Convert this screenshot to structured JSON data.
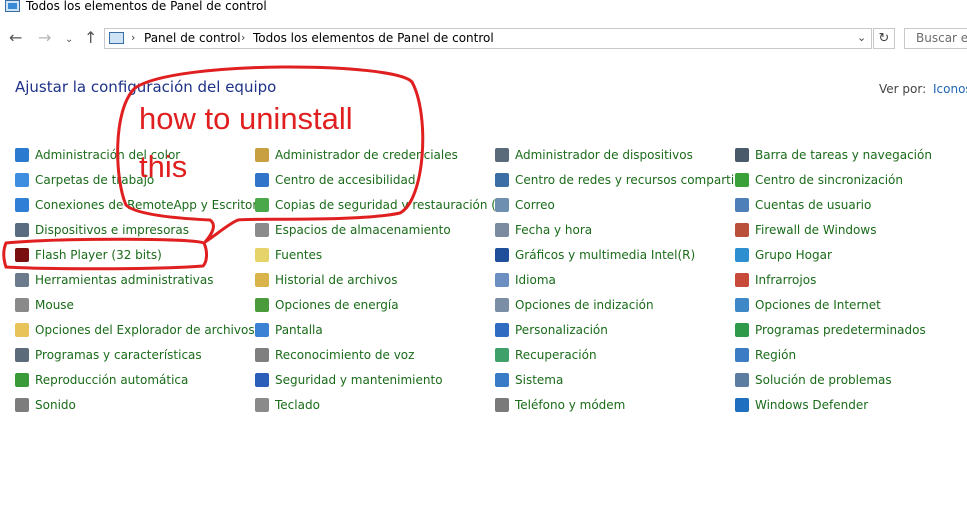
{
  "window": {
    "title": "Todos los elementos de Panel de control"
  },
  "nav": {
    "back_icon": "arrow-left-icon",
    "forward_icon": "arrow-right-icon",
    "recent_icon": "chevron-down-icon",
    "up_icon": "arrow-up-icon",
    "breadcrumbs": [
      "Panel de control",
      "Todos los elementos de Panel de control"
    ],
    "refresh_icon": "refresh-icon",
    "search_placeholder": "Buscar en"
  },
  "header": {
    "title": "Ajustar la configuración del equipo",
    "view_by_label": "Ver por:",
    "view_by_value": "Iconos"
  },
  "columns": [
    [
      {
        "label": "Administración del color",
        "icon": "monitor-color-icon",
        "color": "#2a7bd0"
      },
      {
        "label": "Carpetas de trabajo",
        "icon": "work-folders-icon",
        "color": "#3d8ee0"
      },
      {
        "label": "Conexiones de RemoteApp y Escritorio",
        "icon": "remoteapp-icon",
        "color": "#2f7fd6"
      },
      {
        "label": "Dispositivos e impresoras",
        "icon": "printer-icon",
        "color": "#5a6d80"
      },
      {
        "label": "Flash Player (32 bits)",
        "icon": "flash-player-icon",
        "color": "#7a0f0f"
      },
      {
        "label": "Herramientas administrativas",
        "icon": "admin-tools-icon",
        "color": "#6b7b8c"
      },
      {
        "label": "Mouse",
        "icon": "mouse-icon",
        "color": "#8a8a8a"
      },
      {
        "label": "Opciones del Explorador de archivos",
        "icon": "folder-options-icon",
        "color": "#e8c35a"
      },
      {
        "label": "Programas y características",
        "icon": "programs-icon",
        "color": "#5c6b7a"
      },
      {
        "label": "Reproducción automática",
        "icon": "autoplay-icon",
        "color": "#3a9a3a"
      },
      {
        "label": "Sonido",
        "icon": "speaker-icon",
        "color": "#7d7d7d"
      }
    ],
    [
      {
        "label": "Administrador de credenciales",
        "icon": "credential-vault-icon",
        "color": "#c8a040"
      },
      {
        "label": "Centro de accesibilidad",
        "icon": "accessibility-icon",
        "color": "#2f74c8"
      },
      {
        "label": "Copias de seguridad y restauración (…",
        "icon": "backup-icon",
        "color": "#4aa84a"
      },
      {
        "label": "Espacios de almacenamiento",
        "icon": "storage-spaces-icon",
        "color": "#8b8b8b"
      },
      {
        "label": "Fuentes",
        "icon": "fonts-icon",
        "color": "#e6d36a"
      },
      {
        "label": "Historial de archivos",
        "icon": "file-history-icon",
        "color": "#d9b44a"
      },
      {
        "label": "Opciones de energía",
        "icon": "power-options-icon",
        "color": "#4b9b3c"
      },
      {
        "label": "Pantalla",
        "icon": "display-icon",
        "color": "#3b82d4"
      },
      {
        "label": "Reconocimiento de voz",
        "icon": "microphone-icon",
        "color": "#7f7f7f"
      },
      {
        "label": "Seguridad y mantenimiento",
        "icon": "flag-icon",
        "color": "#2b5fb8"
      },
      {
        "label": "Teclado",
        "icon": "keyboard-icon",
        "color": "#8a8a8a"
      }
    ],
    [
      {
        "label": "Administrador de dispositivos",
        "icon": "device-manager-icon",
        "color": "#5a6a7a"
      },
      {
        "label": "Centro de redes y recursos comparti…",
        "icon": "network-center-icon",
        "color": "#3a6ea5"
      },
      {
        "label": "Correo",
        "icon": "mail-icon",
        "color": "#6f8fb0"
      },
      {
        "label": "Fecha y hora",
        "icon": "clock-icon",
        "color": "#7c8ca0"
      },
      {
        "label": "Gráficos y multimedia Intel(R)",
        "icon": "intel-graphics-icon",
        "color": "#1f4f9a"
      },
      {
        "label": "Idioma",
        "icon": "language-icon",
        "color": "#6a8fc0"
      },
      {
        "label": "Opciones de indización",
        "icon": "indexing-icon",
        "color": "#7a8ea6"
      },
      {
        "label": "Personalización",
        "icon": "personalization-icon",
        "color": "#2f6bc0"
      },
      {
        "label": "Recuperación",
        "icon": "recovery-icon",
        "color": "#3fa06a"
      },
      {
        "label": "Sistema",
        "icon": "system-icon",
        "color": "#3a7bc8"
      },
      {
        "label": "Teléfono y módem",
        "icon": "phone-modem-icon",
        "color": "#7a7a7a"
      }
    ],
    [
      {
        "label": "Barra de tareas y navegación",
        "icon": "taskbar-icon",
        "color": "#4a5a6a"
      },
      {
        "label": "Centro de sincronización",
        "icon": "sync-center-icon",
        "color": "#3aa03a"
      },
      {
        "label": "Cuentas de usuario",
        "icon": "user-accounts-icon",
        "color": "#4e7fb8"
      },
      {
        "label": "Firewall de Windows",
        "icon": "firewall-icon",
        "color": "#b8503a"
      },
      {
        "label": "Grupo Hogar",
        "icon": "homegroup-icon",
        "color": "#2d8fcf"
      },
      {
        "label": "Infrarrojos",
        "icon": "infrared-icon",
        "color": "#c84a3a"
      },
      {
        "label": "Opciones de Internet",
        "icon": "internet-options-icon",
        "color": "#3f88c8"
      },
      {
        "label": "Programas predeterminados",
        "icon": "default-programs-icon",
        "color": "#2f9a4a"
      },
      {
        "label": "Región",
        "icon": "region-icon",
        "color": "#3b7cc4"
      },
      {
        "label": "Solución de problemas",
        "icon": "troubleshooting-icon",
        "color": "#5a7da0"
      },
      {
        "label": "Windows Defender",
        "icon": "windows-defender-icon",
        "color": "#1f6fc0"
      }
    ]
  ],
  "annotation": {
    "line1": "how to uninstall",
    "line2": "this",
    "color": "#e02020"
  }
}
